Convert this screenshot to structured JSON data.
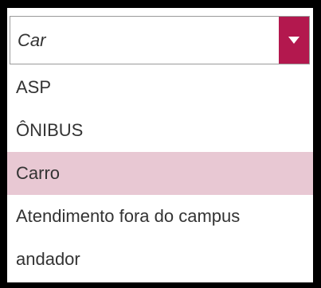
{
  "select": {
    "value": "Car",
    "toggle_icon": "chevron-down-icon",
    "accent_color": "#b3184e"
  },
  "options": [
    {
      "label": "ASP",
      "highlighted": false
    },
    {
      "label": "ÔNIBUS",
      "highlighted": false
    },
    {
      "label": "Carro",
      "highlighted": true
    },
    {
      "label": "Atendimento fora do campus",
      "highlighted": false
    },
    {
      "label": "andador",
      "highlighted": false
    }
  ],
  "colors": {
    "highlight": "#e8c8d3",
    "frame": "#000000"
  }
}
